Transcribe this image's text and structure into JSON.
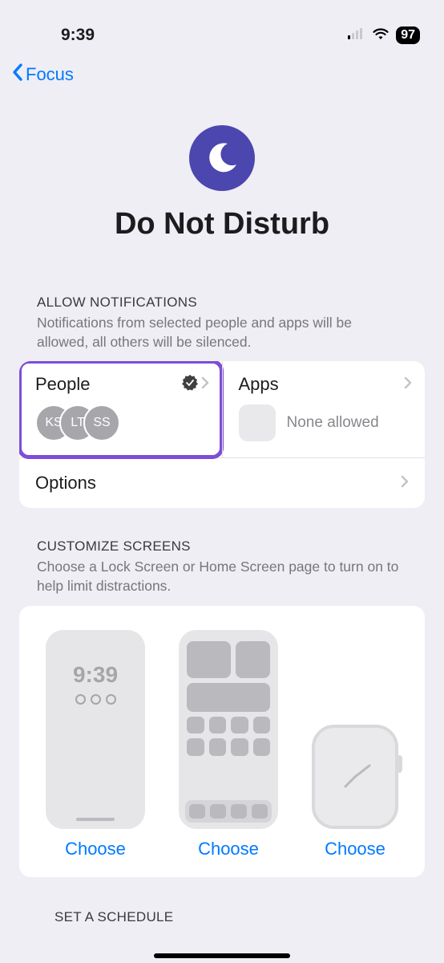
{
  "status": {
    "time": "9:39",
    "battery": "97"
  },
  "nav": {
    "back_label": "Focus"
  },
  "header": {
    "title": "Do Not Disturb"
  },
  "allow": {
    "header": "ALLOW NOTIFICATIONS",
    "description": "Notifications from selected people and apps will be allowed, all others will be silenced.",
    "people_label": "People",
    "people_avatars": [
      "KS",
      "LT",
      "SS"
    ],
    "apps_label": "Apps",
    "apps_status": "None allowed",
    "options_label": "Options"
  },
  "customize": {
    "header": "CUSTOMIZE SCREENS",
    "description": "Choose a Lock Screen or Home Screen page to turn on to help limit distractions.",
    "lock_time": "9:39",
    "choose_label": "Choose"
  },
  "schedule": {
    "header": "SET A SCHEDULE"
  }
}
